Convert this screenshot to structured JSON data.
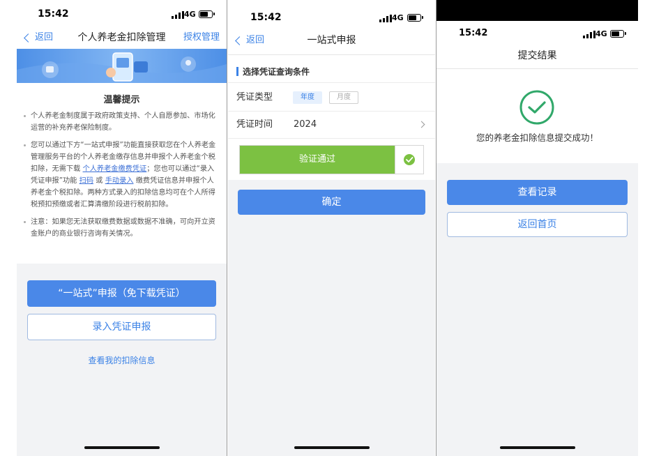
{
  "status": {
    "time": "15:42",
    "network": "4G"
  },
  "screen1": {
    "back_label": "返回",
    "title": "个人养老金扣除管理",
    "right_action": "授权管理",
    "notice_title": "温馨提示",
    "p1": "个人养老金制度属于政府政策支持、个人自愿参加、市场化运营的补充养老保险制度。",
    "p2_a": "您可以通过下方“一站式申报”功能直接获取您在个人养老金管理服务平台的个人养老金缴存信息并申报个人养老金个税扣除，无需下载",
    "p2_link1": "个人养老金缴费凭证",
    "p2_b": "；您也可以通过“录入凭证申报”功能",
    "p2_link2": "扫码",
    "p2_c": "或",
    "p2_link3": "手动录入",
    "p2_d": "缴费凭证信息并申报个人养老金个税扣除。两种方式录入的扣除信息均可在个人所得税预扣预缴或者汇算清缴阶段进行税前扣除。",
    "p3": "注意：如果您无法获取缴费数据或数据不准确，可向开立资金账户的商业银行咨询有关情况。",
    "btn_primary": "“一站式”申报（免下载凭证）",
    "btn_secondary": "录入凭证申报",
    "link_view": "查看我的扣除信息"
  },
  "screen2": {
    "back_label": "返回",
    "title": "一站式申报",
    "section_title": "选择凭证查询条件",
    "type_label": "凭证类型",
    "type_opt_year": "年度",
    "type_opt_month": "月度",
    "time_label": "凭证时间",
    "time_value": "2024",
    "verify_label": "验证通过",
    "confirm_button": "确定"
  },
  "screen3": {
    "title": "提交结果",
    "success_text": "您的养老金扣除信息提交成功！",
    "btn_primary": "查看记录",
    "btn_secondary": "返回首页"
  },
  "colors": {
    "accent": "#4a88e8",
    "success": "#31a86a",
    "verify_green": "#7cc142"
  }
}
